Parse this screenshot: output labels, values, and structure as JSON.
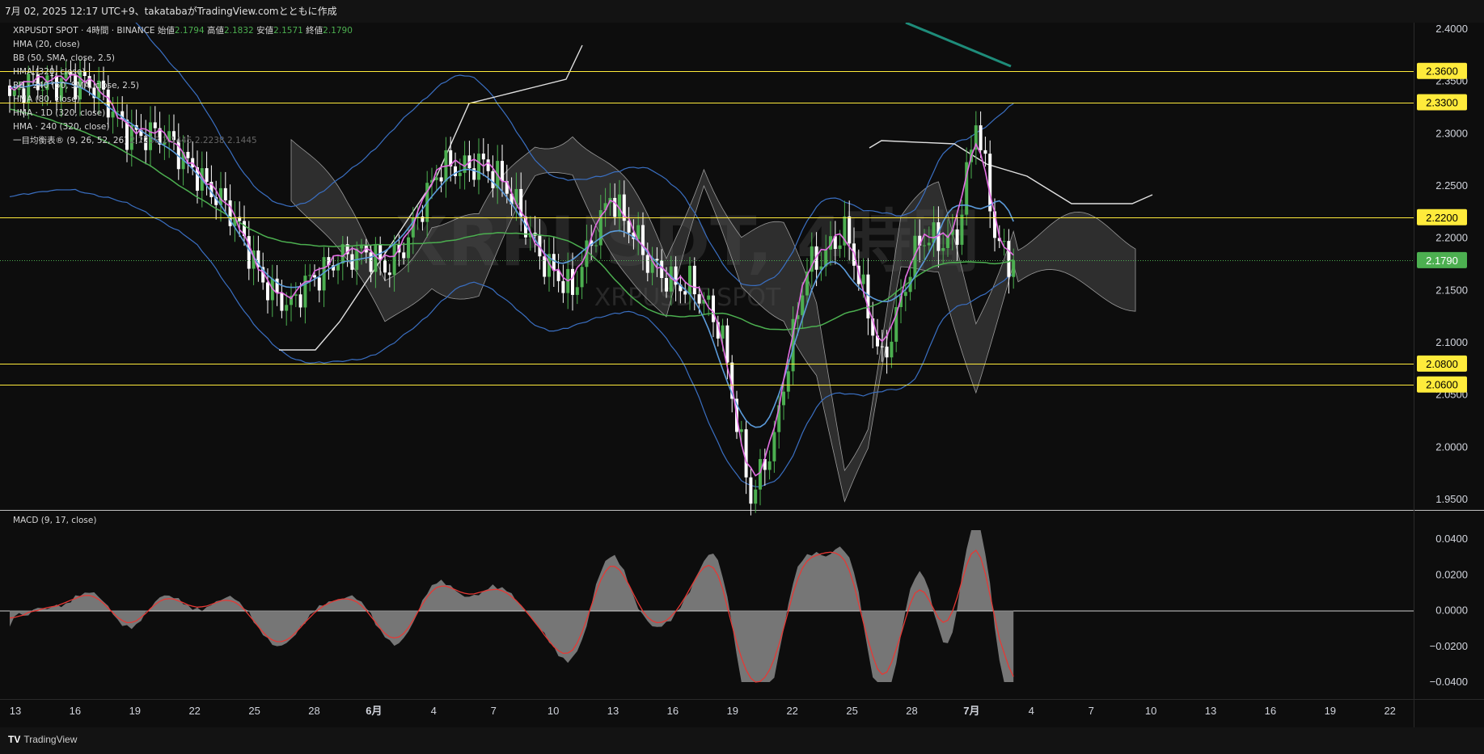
{
  "header": {
    "caption": "7月 02, 2025 12:17 UTC+9、takatabaがTradingView.comとともに作成"
  },
  "legend": {
    "symbol": "XRPUSDT SPOT · 4時間 · BINANCE",
    "ohlc": [
      {
        "label": "始値",
        "value": "2.1794"
      },
      {
        "label": "高値",
        "value": "2.1832"
      },
      {
        "label": "安値",
        "value": "2.1571"
      },
      {
        "label": "終値",
        "value": "2.1790"
      }
    ],
    "indicators": [
      "HMA (20, close)",
      "BB (50, SMA, close, 2.5)",
      "HMA (320, close)",
      "BB · 240 (50, SMA, close, 2.5)",
      "HMA (80, close)",
      "HMA · 1D (320, close)",
      "HMA · 240 (320, close)",
      "一目均衡表® (9, 26, 52, 26)"
    ],
    "ichimoku_values": [
      "2.2238",
      "2.1445",
      "2.2238",
      "2.1445"
    ]
  },
  "watermark": {
    "main": "XRPUSDT, 4時間",
    "sub": "XRPUSDT SPOT"
  },
  "price_axis": {
    "ticks": [
      "2.4000",
      "2.3500",
      "2.3000",
      "2.2500",
      "2.2000",
      "2.1500",
      "2.1000",
      "2.0500",
      "2.0000",
      "1.9500"
    ],
    "levels": [
      {
        "label": "2.3600",
        "value": 2.36
      },
      {
        "label": "2.3300",
        "value": 2.33
      },
      {
        "label": "2.2200",
        "value": 2.22
      },
      {
        "label": "2.0800",
        "value": 2.08
      },
      {
        "label": "2.0600",
        "value": 2.06
      }
    ],
    "current": {
      "label": "2.1790",
      "value": 2.179
    }
  },
  "macd": {
    "title": "MACD (9, 17, close)",
    "ticks": [
      "0.0400",
      "0.0200",
      "0.0000",
      "−0.0200",
      "−0.0400"
    ]
  },
  "time_axis": {
    "labels": [
      "13",
      "16",
      "19",
      "22",
      "25",
      "28",
      "6月",
      "4",
      "7",
      "10",
      "13",
      "16",
      "19",
      "22",
      "25",
      "28",
      "7月",
      "4",
      "7",
      "10",
      "13",
      "16",
      "19",
      "22"
    ]
  },
  "footer": {
    "brand": "TradingView"
  },
  "colors": {
    "bull": "#4caf50",
    "bear": "#ffffff",
    "level": "#ffeb3b",
    "hma_fast": "#e36ee3",
    "hma_mid": "#5b9bdb",
    "hma_slow": "#4caf50",
    "bb": "#3a6fc2",
    "cloud": "#4a4a4a",
    "macd_line": "#e53935",
    "macd_area": "#8a8a8a",
    "upper_trend": "#1e8c7a"
  }
}
